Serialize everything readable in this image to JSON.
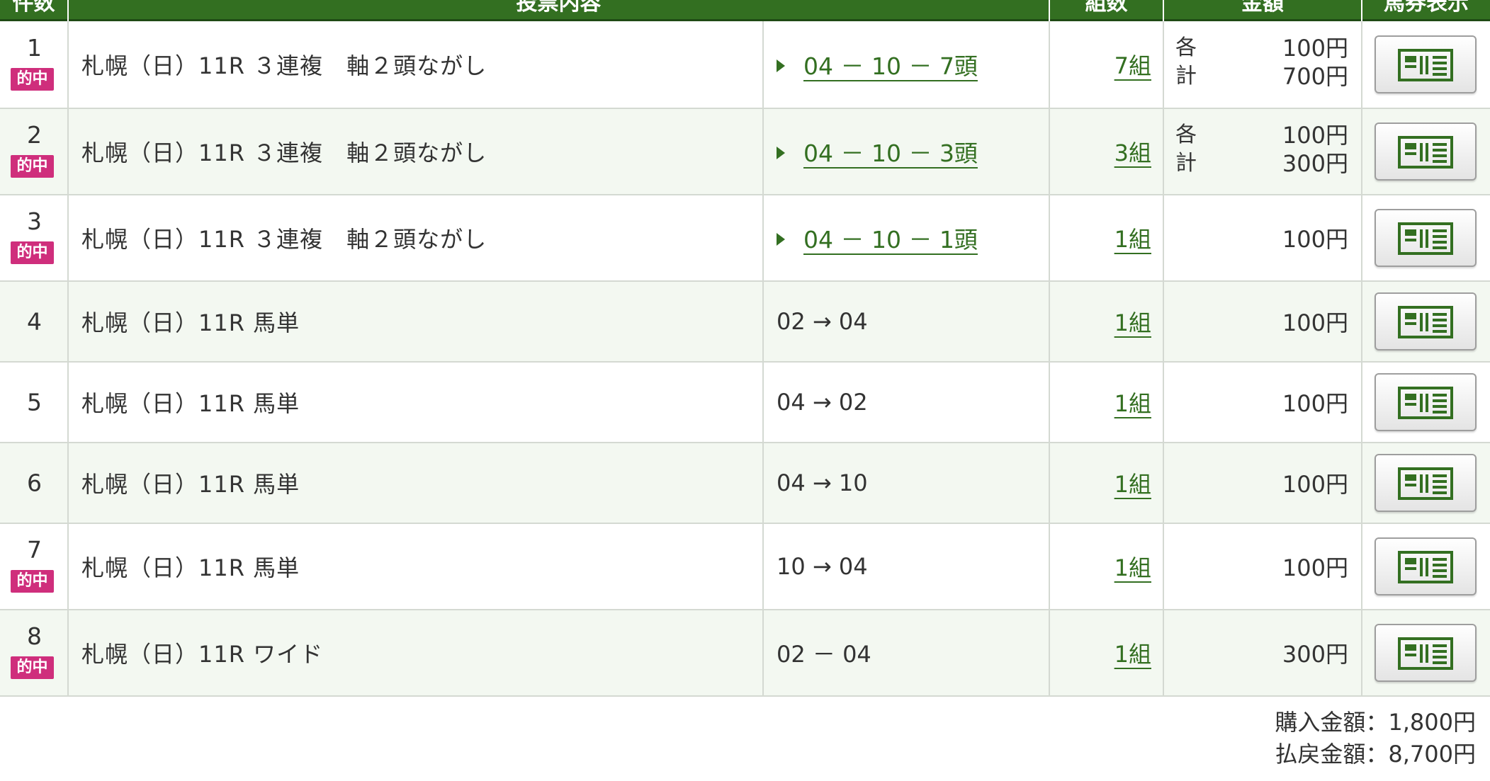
{
  "colors": {
    "header_bg": "#336f21",
    "hit_badge": "#cf2e7c",
    "link": "#336f21",
    "alt_row": "#f3f8f1"
  },
  "header": {
    "col_no": "件数",
    "col_desc": "投票内容",
    "col_count": "組数",
    "col_amount": "金額",
    "col_ticket": "馬券表示"
  },
  "hit_label": "的中",
  "ticket_button_icon": "ticket-icon",
  "rows": [
    {
      "no": "1",
      "hit": true,
      "desc": "札幌（日）11R ３連複　軸２頭ながし",
      "selection": "04 － 10 －  7頭",
      "selection_link": true,
      "count": "7組",
      "amount_each_label": "各",
      "amount_each": "100円",
      "amount_total_label": "計",
      "amount_total": "700円"
    },
    {
      "no": "2",
      "hit": true,
      "desc": "札幌（日）11R ３連複　軸２頭ながし",
      "selection": "04 － 10 －  3頭",
      "selection_link": true,
      "count": "3組",
      "amount_each_label": "各",
      "amount_each": "100円",
      "amount_total_label": "計",
      "amount_total": "300円"
    },
    {
      "no": "3",
      "hit": true,
      "desc": "札幌（日）11R ３連複　軸２頭ながし",
      "selection": "04 － 10 －  1頭",
      "selection_link": true,
      "count": "1組",
      "amount": "100円"
    },
    {
      "no": "4",
      "hit": false,
      "desc": "札幌（日）11R 馬単",
      "selection": "02 → 04",
      "selection_link": false,
      "count": "1組",
      "amount": "100円"
    },
    {
      "no": "5",
      "hit": false,
      "desc": "札幌（日）11R 馬単",
      "selection": "04 → 02",
      "selection_link": false,
      "count": "1組",
      "amount": "100円"
    },
    {
      "no": "6",
      "hit": false,
      "desc": "札幌（日）11R 馬単",
      "selection": "04 → 10",
      "selection_link": false,
      "count": "1組",
      "amount": "100円"
    },
    {
      "no": "7",
      "hit": true,
      "desc": "札幌（日）11R 馬単",
      "selection": "10 → 04",
      "selection_link": false,
      "count": "1組",
      "amount": "100円"
    },
    {
      "no": "8",
      "hit": true,
      "desc": "札幌（日）11R ワイド",
      "selection": "02 － 04",
      "selection_link": false,
      "count": "1組",
      "amount": "300円"
    }
  ],
  "footer": {
    "purchase": "購入金額：1,800円",
    "refund": "払戻金額：8,700円"
  }
}
